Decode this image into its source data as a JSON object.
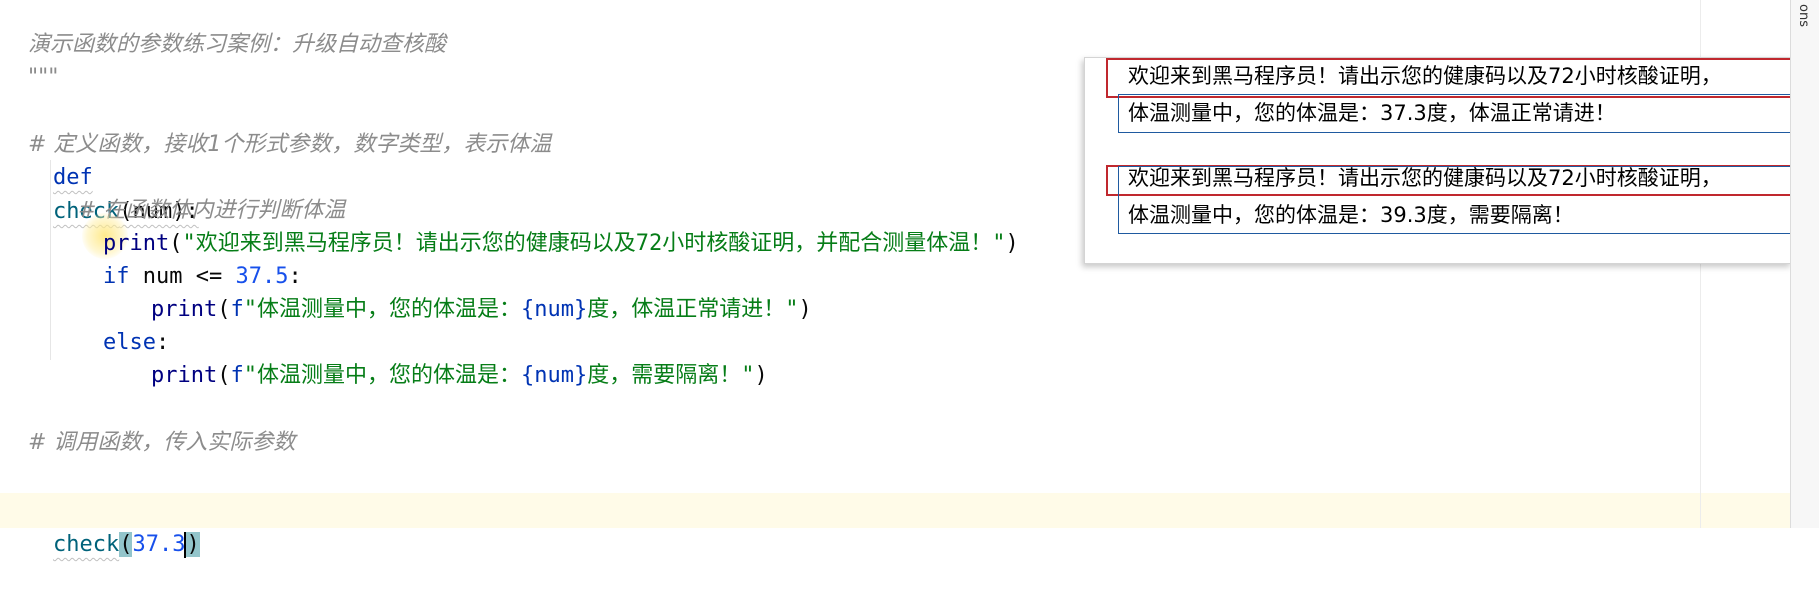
{
  "editor": {
    "lines": {
      "doc_title": "演示函数的参数练习案例：升级自动查核酸",
      "doc_close": "\"\"\"",
      "comment_define": "# 定义函数，接收1个形式参数，数字类型，表示体温",
      "def_kw": "def",
      "def_name": "check",
      "def_params": "(num):",
      "comment_body": "# 在函数体内进行判断体温",
      "print_kw": "print",
      "print1_open": "(",
      "print1_str": "\"欢迎来到黑马程序员！请出示您的健康码以及72小时核酸证明，并配合测量体温！\"",
      "print1_close": ")",
      "if_kw": "if",
      "if_cond": " num <= ",
      "if_num": "37.5",
      "if_colon": ":",
      "print2_open": "(",
      "print2_prefix": "f",
      "print2_str_a": "\"体温测量中，您的体温是：",
      "print2_var": "{num}",
      "print2_str_b": "度，体温正常请进！\"",
      "print2_close": ")",
      "else_kw": "else",
      "else_colon": ":",
      "print3_open": "(",
      "print3_prefix": "f",
      "print3_str_a": "\"体温测量中，您的体温是：",
      "print3_var": "{num}",
      "print3_str_b": "度，需要隔离！\"",
      "print3_close": ")",
      "comment_call": "# 调用函数，传入实际参数",
      "call_name": "check",
      "call_open": "(",
      "call_arg": "37.3",
      "call_close": ")"
    }
  },
  "output": {
    "lines": [
      "欢迎来到黑马程序员！请出示您的健康码以及72小时核酸证明，",
      "体温测量中，您的体温是：37.3度，体温正常请进！",
      "欢迎来到黑马程序员！请出示您的健康码以及72小时核酸证明，",
      "体温测量中，您的体温是：39.3度，需要隔离！"
    ]
  },
  "right_bar": {
    "label": "ons"
  },
  "colors": {
    "keyword": "#0033b3",
    "string": "#067d17",
    "number": "#1750eb",
    "comment": "#8c8c8c",
    "annotation_red": "#c0282e",
    "annotation_blue": "#1f5aa0"
  }
}
